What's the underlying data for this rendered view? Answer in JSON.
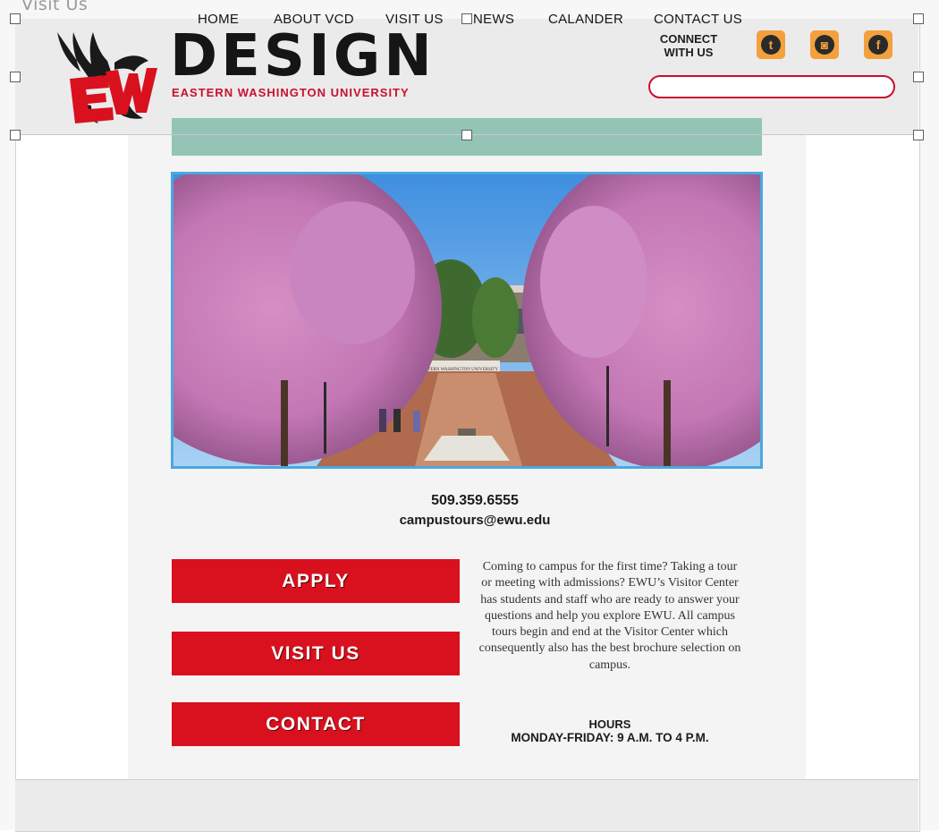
{
  "page": {
    "title": "Visit Us"
  },
  "header": {
    "wordmark": "DESIGN",
    "subtitle": "EASTERN WASHINGTON UNIVERSITY",
    "logo_letters": "EW",
    "connect_line1": "CONNECT",
    "connect_line2": "WITH US",
    "search_value": ""
  },
  "social": [
    {
      "icon": "twitter-icon",
      "glyph": "t"
    },
    {
      "icon": "instagram-icon",
      "glyph": "◙"
    },
    {
      "icon": "facebook-icon",
      "glyph": "f"
    }
  ],
  "nav": {
    "items": [
      "HOME",
      "ABOUT VCD",
      "VISIT US",
      "NEWS",
      "CALANDER",
      "CONTACT US"
    ]
  },
  "contact": {
    "phone": "509.359.6555",
    "email": "campustours@ewu.edu"
  },
  "buttons": {
    "apply": "APPLY",
    "visit": "VISIT US",
    "contact": "CONTACT"
  },
  "blurb": "Coming to campus for the first time? Taking a tour or meeting with admissions? EWU’s Visitor Center has students and staff who are ready to answer your questions and help you explore EWU. All campus tours begin and end at the Visitor Center which consequently also has the best brochure selection on campus.",
  "hero": {
    "sign_text": "EASTERN WASHINGTON UNIVERSITY"
  },
  "hours": {
    "label": "HOURS",
    "value": "MONDAY-FRIDAY: 9 A.M. TO 4 P.M."
  },
  "colors": {
    "brand_red": "#d9101e",
    "nav_green": "#94c4b5",
    "social_orange": "#f3a03d",
    "hero_border": "#4aa8e0"
  }
}
